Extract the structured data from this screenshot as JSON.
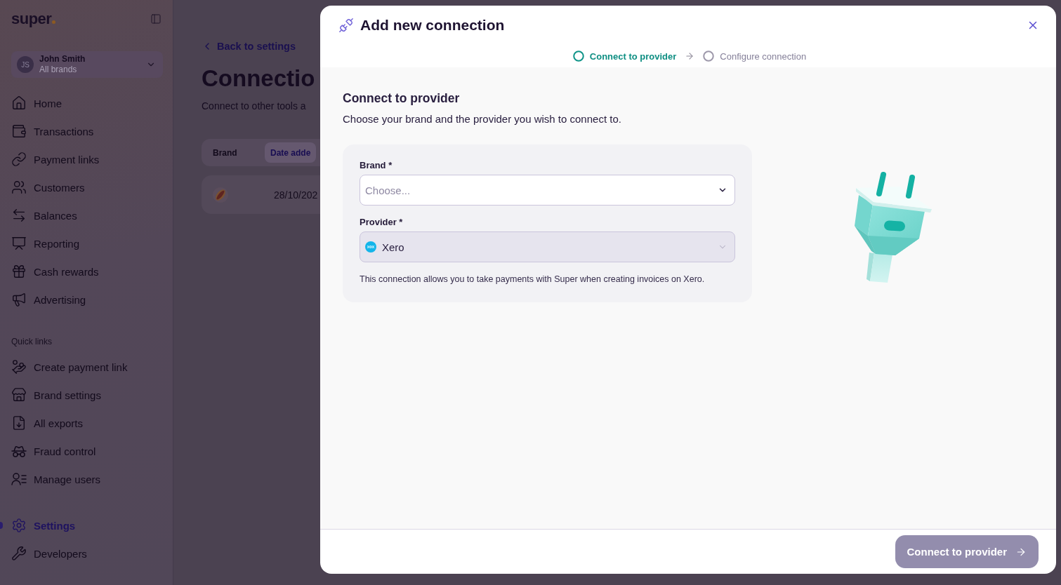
{
  "sidebar": {
    "logo": "super",
    "user": {
      "initials": "JS",
      "name": "John Smith",
      "subtitle": "All brands"
    },
    "nav_items": [
      {
        "label": "Home",
        "selected": false
      },
      {
        "label": "Transactions",
        "selected": false
      },
      {
        "label": "Payment links",
        "selected": false
      },
      {
        "label": "Customers",
        "selected": false
      },
      {
        "label": "Balances",
        "selected": false
      },
      {
        "label": "Reporting",
        "selected": false
      },
      {
        "label": "Cash rewards",
        "selected": false
      },
      {
        "label": "Advertising",
        "selected": false
      }
    ],
    "quick_links": {
      "title": "Quick links",
      "items": [
        {
          "label": "Create payment link",
          "selected": false
        },
        {
          "label": "Brand settings",
          "selected": false
        },
        {
          "label": "All exports",
          "selected": false
        },
        {
          "label": "Fraud control",
          "selected": false
        },
        {
          "label": "Manage users",
          "selected": false
        }
      ]
    },
    "footer_items": [
      {
        "label": "Settings",
        "selected": true
      },
      {
        "label": "Developers",
        "selected": false
      }
    ]
  },
  "page": {
    "back_link": "Back to settings",
    "title": "Connectio",
    "subtitle": "Connect to other tools a",
    "table": {
      "columns": [
        {
          "label": "Brand",
          "selected": false
        },
        {
          "label": "Date adde",
          "selected": true
        }
      ],
      "rows": [
        {
          "date_added": "28/10/202"
        }
      ]
    }
  },
  "modal": {
    "title": "Add new connection",
    "steps": [
      {
        "label": "Connect to provider",
        "selected": true
      },
      {
        "label": "Configure connection",
        "selected": false
      }
    ],
    "heading": "Connect to provider",
    "description": "Choose your brand and the provider you wish to connect to.",
    "fields": [
      {
        "label": "Brand *",
        "placeholder": "Choose...",
        "disabled": false
      },
      {
        "label": "Provider *",
        "value": "Xero",
        "disabled": true
      }
    ],
    "help_text": "This connection allows you to take payments with Super when creating invoices on Xero.",
    "submit": {
      "label": "Connect to provider",
      "disabled": true
    }
  }
}
